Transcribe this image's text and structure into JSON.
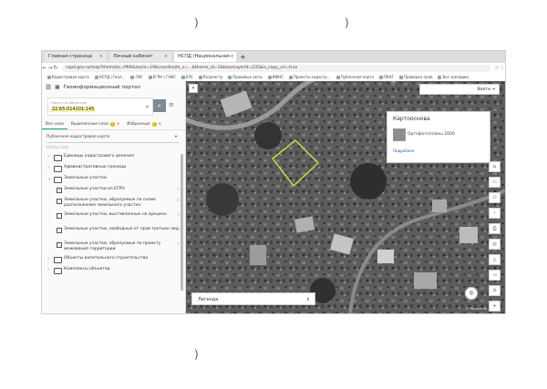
{
  "browser": {
    "tabs": [
      {
        "label": "Главная страница",
        "active": false
      },
      {
        "label": "Личный кабинет",
        "active": false
      },
      {
        "label": "НСПД (Национальная с",
        "active": true
      }
    ],
    "new_tab": "+",
    "url": "nspd.gov.ru/map?thematic=PKK&zoom=19&coordinate_x=...&theme_id=1&baseLayerId=235&is_copy_url=true",
    "bookmarks": [
      "Кадастровая карта",
      "НСПД (Геоп…",
      "ГИС",
      "ЕГРН | ГАИС",
      "ЕРС",
      "Росреестр",
      "Правовые акты",
      "ИФНС",
      "Проекты кадастр…",
      "Публичная карта",
      "ПКАТ",
      "Проверка прав",
      "Все закладки"
    ]
  },
  "sidebar": {
    "menu_icon": "menu-icon",
    "portal_title": "Геоинформационный портал",
    "search": {
      "placeholder": "Поиск по объектам",
      "value": "22:65:014101:145",
      "clear": "×",
      "button": "⌕"
    },
    "filter_icon": "≡",
    "tabs": [
      {
        "label": "Все слои",
        "badge": ""
      },
      {
        "label": "Выделенные слои",
        "badge": "2"
      },
      {
        "label": "Избранные",
        "badge": "0"
      }
    ],
    "basemap_label": "Публичная кадастровая карта",
    "basemap_dropdown": "▾",
    "layer_search_placeholder": "Найти слой",
    "tree": [
      {
        "label": "Единицы кадастрового деления",
        "level": 0,
        "type": "folder",
        "chev": "›"
      },
      {
        "label": "Административные границы",
        "level": 0,
        "type": "folder",
        "chev": "›"
      },
      {
        "label": "Земельные участки",
        "level": 0,
        "type": "folder",
        "chev": "⌄"
      },
      {
        "label": "Земельные участки из ЕГРН",
        "level": 1,
        "type": "check",
        "checked": true
      },
      {
        "label": "Земельные участки, образуемые по схеме расположения земельного участка",
        "level": 1,
        "type": "check",
        "checked": false
      },
      {
        "label": "Земельные участки, выставленные на аукцион",
        "level": 1,
        "type": "check",
        "checked": false
      },
      {
        "label": "Земельные участки, свободные от прав третьих лиц",
        "level": 1,
        "type": "check",
        "checked": false
      },
      {
        "label": "Земельные участки, образуемые по проекту межевания территории",
        "level": 1,
        "type": "check",
        "checked": false
      },
      {
        "label": "Объекты капитального строительства",
        "level": 0,
        "type": "folder",
        "chev": "›"
      },
      {
        "label": "Комплексы объектов",
        "level": 0,
        "type": "folder",
        "chev": "›"
      }
    ],
    "star": "☆",
    "check_mark": "✓"
  },
  "map": {
    "collapse_icon": "«",
    "login_label": "Войти",
    "login_icon": "⇥",
    "popup": {
      "title": "Картооснова",
      "item": "Ортофотопланы 2000",
      "more": "Подробнее"
    },
    "tools": [
      "⌂",
      "▭",
      "⚇",
      "‹",
      "⎙",
      "◎",
      "△",
      "◅",
      "⊙",
      "+",
      "−"
    ],
    "legend_label": "Легенда",
    "legend_arrow": "⇕",
    "round_button": "◎",
    "attribution": "© Росреестр"
  },
  "scan_marks": [
    ")",
    ")",
    ")"
  ]
}
